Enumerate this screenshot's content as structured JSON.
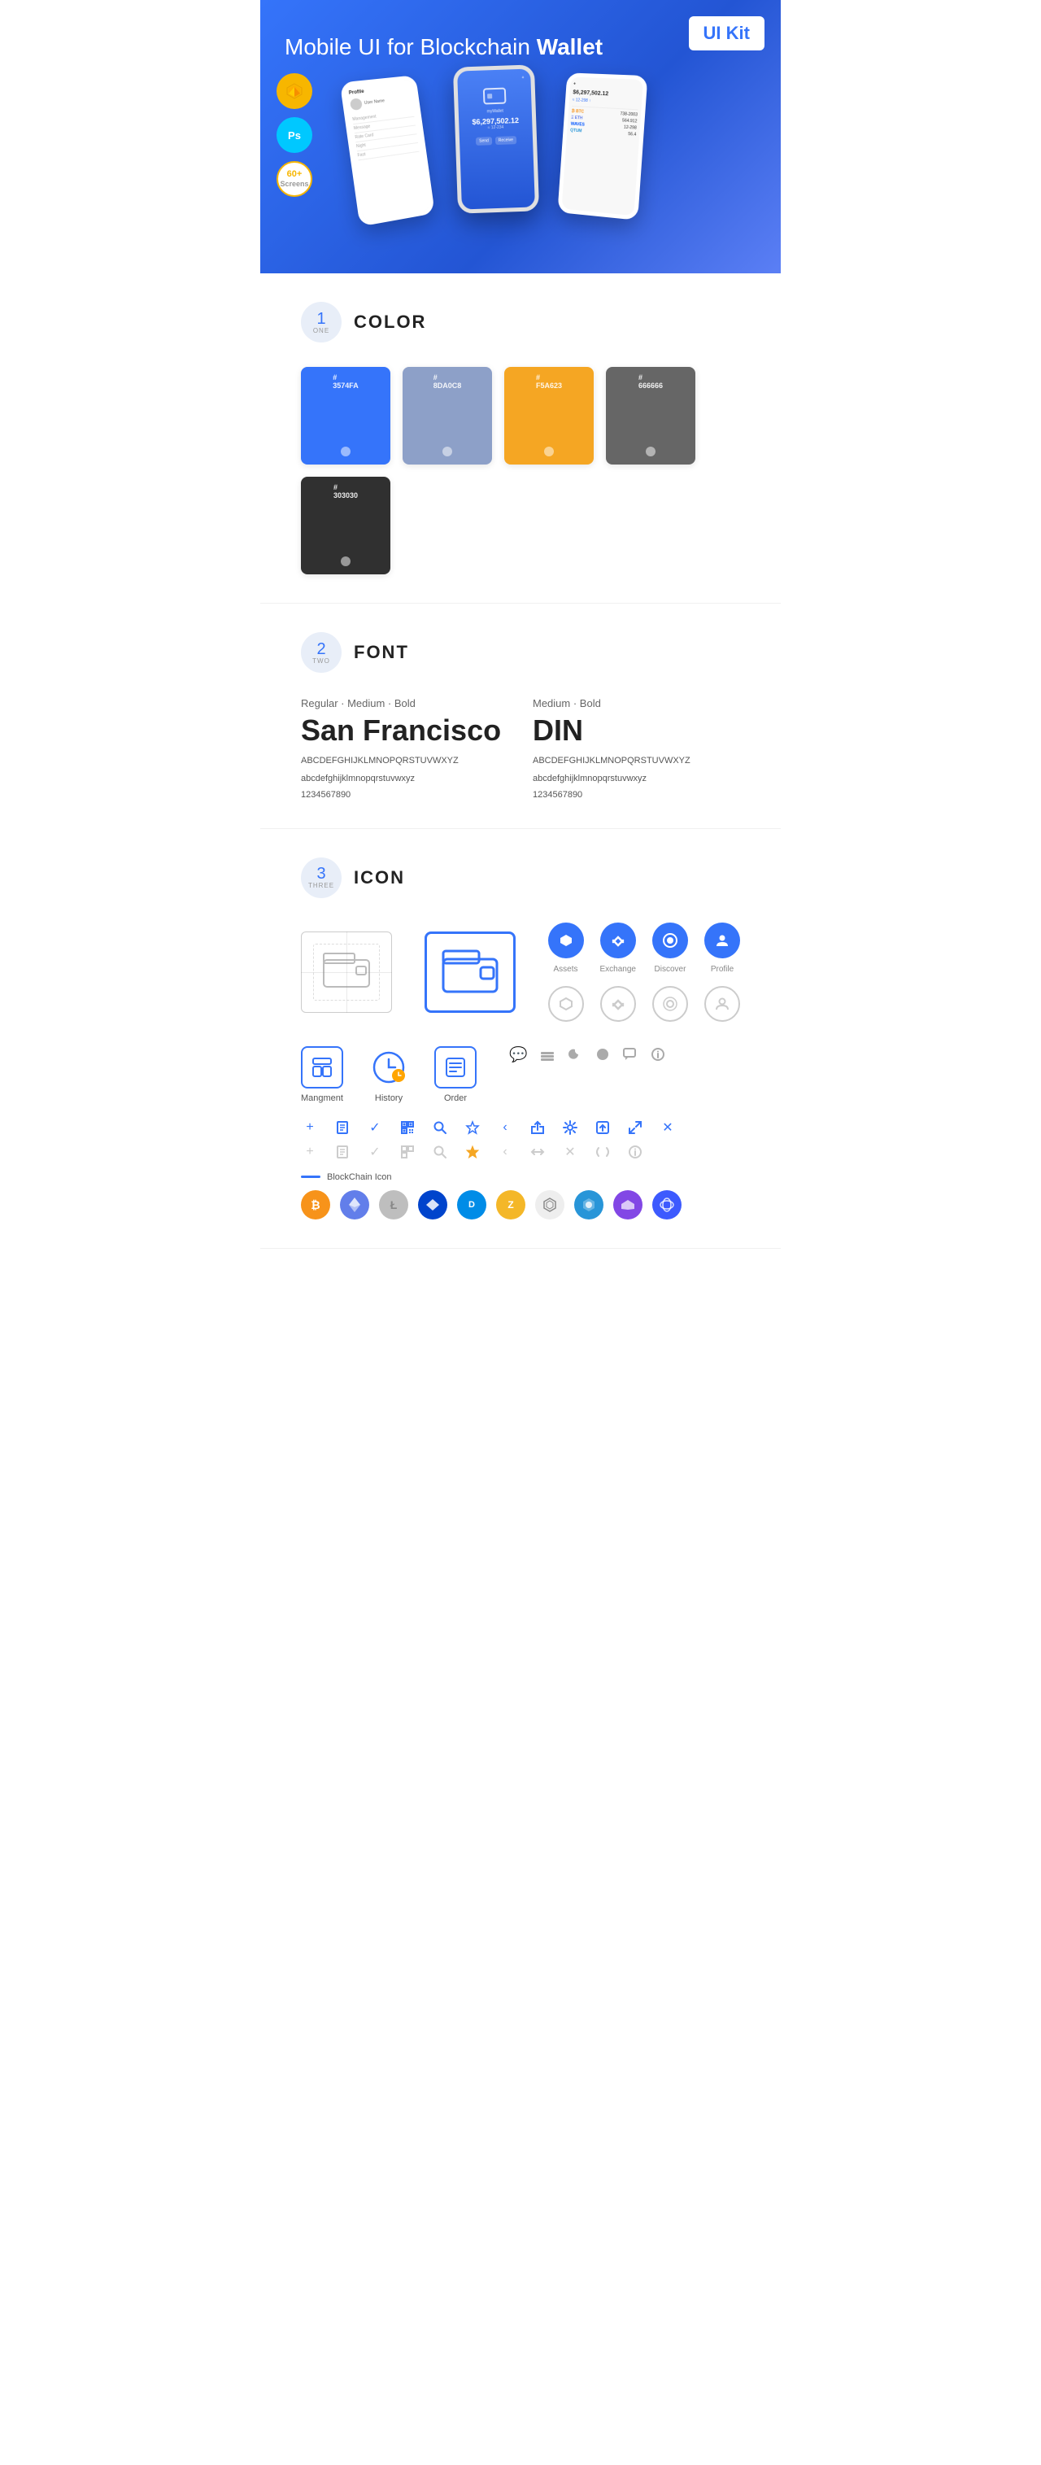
{
  "hero": {
    "title_normal": "Mobile UI for Blockchain ",
    "title_bold": "Wallet",
    "badge": "UI Kit",
    "badge_sketch": "Sketch",
    "badge_ps": "Ps",
    "badge_screens": "60+\nScreens"
  },
  "sections": {
    "color": {
      "number": "1",
      "number_label": "ONE",
      "title": "COLOR",
      "swatches": [
        {
          "hex": "#3574FA",
          "code": "#\n3574FA"
        },
        {
          "hex": "#8DA0C8",
          "code": "#\n8DA0C8"
        },
        {
          "hex": "#F5A623",
          "code": "#\nF5A623"
        },
        {
          "hex": "#666666",
          "code": "#\n666666"
        },
        {
          "hex": "#303030",
          "code": "#\n303030"
        }
      ]
    },
    "font": {
      "number": "2",
      "number_label": "TWO",
      "title": "FONT",
      "font1": {
        "style": "Regular · Medium · Bold",
        "name": "San Francisco",
        "uppercase": "ABCDEFGHIJKLMNOPQRSTUVWXYZ",
        "lowercase": "abcdefghijklmnopqrstuvwxyz",
        "numbers": "1234567890"
      },
      "font2": {
        "style": "Medium · Bold",
        "name": "DIN",
        "uppercase": "ABCDEFGHIJKLMNOPQRSTUVWXYZ",
        "lowercase": "abcdefghijklmnopqrstuvwxyz",
        "numbers": "1234567890"
      }
    },
    "icon": {
      "number": "3",
      "number_label": "THREE",
      "title": "ICON",
      "nav_icons": [
        {
          "label": "Assets"
        },
        {
          "label": "Exchange"
        },
        {
          "label": "Discover"
        },
        {
          "label": "Profile"
        }
      ],
      "app_icons": [
        {
          "label": "Mangment"
        },
        {
          "label": "History"
        },
        {
          "label": "Order"
        }
      ],
      "blockchain_label": "BlockChain Icon",
      "crypto_coins": [
        {
          "symbol": "₿",
          "label": "BTC",
          "class": "ci-btc"
        },
        {
          "symbol": "Ξ",
          "label": "ETH",
          "class": "ci-eth"
        },
        {
          "symbol": "Ł",
          "label": "LTC",
          "class": "ci-ltc"
        },
        {
          "symbol": "◆",
          "label": "WAVES",
          "class": "ci-waves"
        },
        {
          "symbol": "D",
          "label": "DASH",
          "class": "ci-dash"
        },
        {
          "symbol": "Z",
          "label": "ZEC",
          "class": "ci-zcash"
        },
        {
          "symbol": "⬡",
          "label": "IOTA",
          "class": "ci-iota"
        },
        {
          "symbol": "Q",
          "label": "QTUM",
          "class": "ci-qtum"
        },
        {
          "symbol": "▲",
          "label": "MATIC",
          "class": "ci-poly"
        },
        {
          "symbol": "B",
          "label": "BNB",
          "class": "ci-bnb"
        }
      ]
    }
  }
}
